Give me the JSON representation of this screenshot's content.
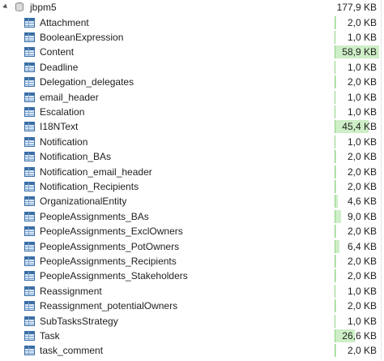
{
  "tree": {
    "root": {
      "label": "jbpm5",
      "size": "177,9 KB"
    },
    "items": [
      {
        "label": "Attachment",
        "size": "2,0 KB",
        "usage_fraction": 0.034
      },
      {
        "label": "BooleanExpression",
        "size": "1,0 KB",
        "usage_fraction": 0.017
      },
      {
        "label": "Content",
        "size": "58,9 KB",
        "usage_fraction": 1.0
      },
      {
        "label": "Deadline",
        "size": "1,0 KB",
        "usage_fraction": 0.017
      },
      {
        "label": "Delegation_delegates",
        "size": "2,0 KB",
        "usage_fraction": 0.034
      },
      {
        "label": "email_header",
        "size": "1,0 KB",
        "usage_fraction": 0.017
      },
      {
        "label": "Escalation",
        "size": "1,0 KB",
        "usage_fraction": 0.017
      },
      {
        "label": "I18NText",
        "size": "45,4 KB",
        "usage_fraction": 0.771
      },
      {
        "label": "Notification",
        "size": "1,0 KB",
        "usage_fraction": 0.017
      },
      {
        "label": "Notification_BAs",
        "size": "2,0 KB",
        "usage_fraction": 0.034
      },
      {
        "label": "Notification_email_header",
        "size": "2,0 KB",
        "usage_fraction": 0.034
      },
      {
        "label": "Notification_Recipients",
        "size": "2,0 KB",
        "usage_fraction": 0.034
      },
      {
        "label": "OrganizationalEntity",
        "size": "4,6 KB",
        "usage_fraction": 0.078
      },
      {
        "label": "PeopleAssignments_BAs",
        "size": "9,0 KB",
        "usage_fraction": 0.153
      },
      {
        "label": "PeopleAssignments_ExclOwners",
        "size": "2,0 KB",
        "usage_fraction": 0.034
      },
      {
        "label": "PeopleAssignments_PotOwners",
        "size": "6,4 KB",
        "usage_fraction": 0.109
      },
      {
        "label": "PeopleAssignments_Recipients",
        "size": "2,0 KB",
        "usage_fraction": 0.034
      },
      {
        "label": "PeopleAssignments_Stakeholders",
        "size": "2,0 KB",
        "usage_fraction": 0.034
      },
      {
        "label": "Reassignment",
        "size": "1,0 KB",
        "usage_fraction": 0.017
      },
      {
        "label": "Reassignment_potentialOwners",
        "size": "2,0 KB",
        "usage_fraction": 0.034
      },
      {
        "label": "SubTasksStrategy",
        "size": "1,0 KB",
        "usage_fraction": 0.017
      },
      {
        "label": "Task",
        "size": "26,6 KB",
        "usage_fraction": 0.452
      },
      {
        "label": "task_comment",
        "size": "2,0 KB",
        "usage_fraction": 0.034
      }
    ]
  },
  "colors": {
    "bar_fill": "#cdeec6",
    "bar_edge": "#8fd183",
    "table_icon": "#3a6ea5"
  },
  "icons": {
    "root": "database-icon",
    "item": "table-icon",
    "expander": "expand-arrow-icon"
  }
}
